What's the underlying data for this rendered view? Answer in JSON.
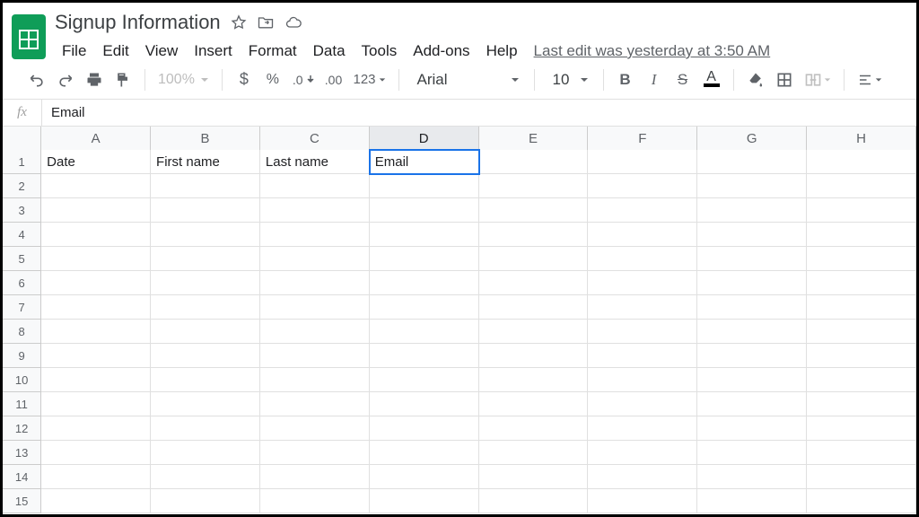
{
  "doc": {
    "title": "Signup Information"
  },
  "menus": {
    "file": "File",
    "edit": "Edit",
    "view": "View",
    "insert": "Insert",
    "format": "Format",
    "data": "Data",
    "tools": "Tools",
    "addons": "Add-ons",
    "help": "Help"
  },
  "last_edit": "Last edit was yesterday at 3:50 AM",
  "toolbar": {
    "zoom": "100%",
    "num_format_label": "123",
    "font": "Arial",
    "font_size": "10"
  },
  "formula": {
    "fx": "fx",
    "value": "Email"
  },
  "columns": [
    "A",
    "B",
    "C",
    "D",
    "E",
    "F",
    "G",
    "H"
  ],
  "selected_col": "D",
  "rows": [
    "1",
    "2",
    "3",
    "4",
    "5",
    "6",
    "7",
    "8",
    "9",
    "10",
    "11",
    "12",
    "13",
    "14",
    "15"
  ],
  "cells": {
    "A1": "Date",
    "B1": "First name",
    "C1": "Last name",
    "D1": "Email"
  },
  "active_cell": "D1"
}
